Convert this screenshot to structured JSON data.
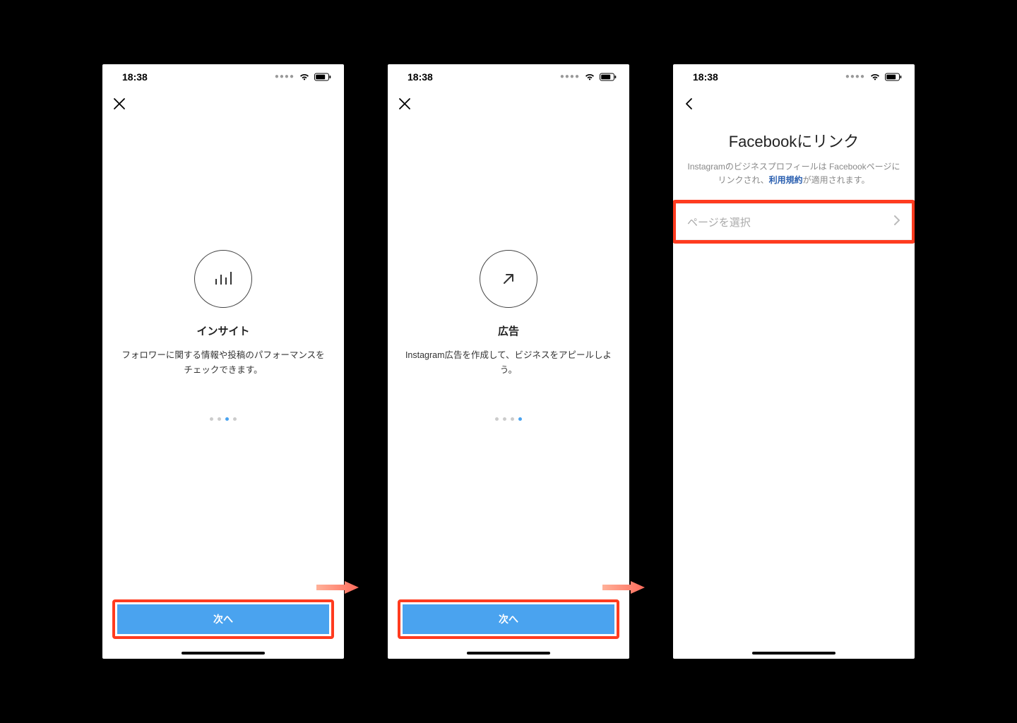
{
  "status": {
    "time": "18:38"
  },
  "screen1": {
    "title": "インサイト",
    "desc": "フォロワーに関する情報や投稿のパフォーマンスをチェックできます。",
    "next": "次へ",
    "activeDot": 2
  },
  "screen2": {
    "title": "広告",
    "desc": "Instagram広告を作成して、ビジネスをアピールしよう。",
    "next": "次へ",
    "activeDot": 3
  },
  "screen3": {
    "title": "Facebookにリンク",
    "sub_pre": "Instagramのビジネスプロフィールは Facebookページにリンクされ、",
    "tos": "利用規約",
    "sub_post": "が適用されます。",
    "select_placeholder": "ページを選択"
  }
}
